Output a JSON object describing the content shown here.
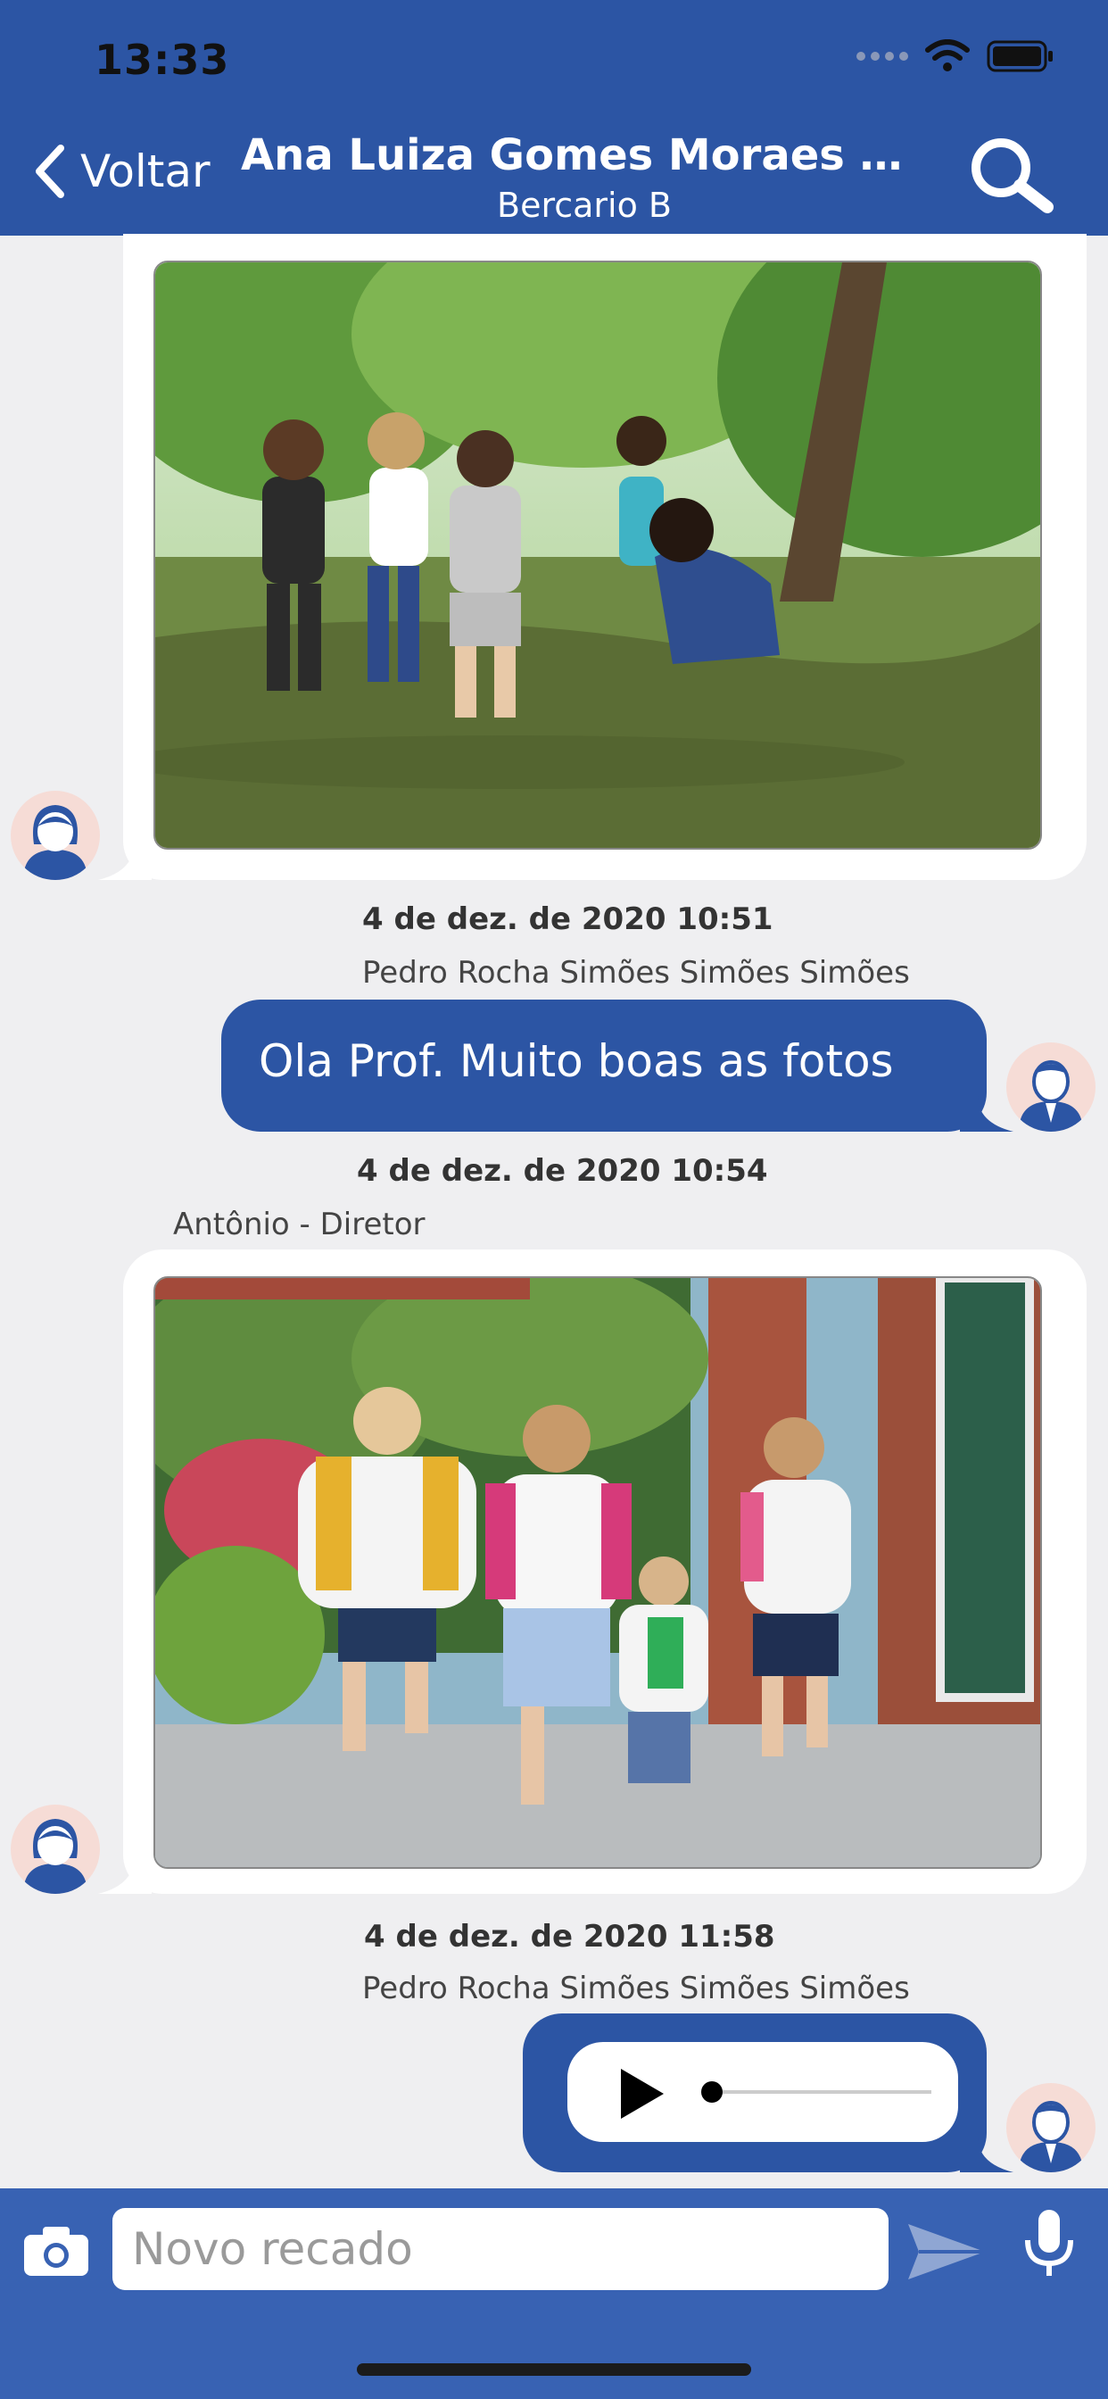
{
  "status_bar": {
    "time": "13:33"
  },
  "header": {
    "back_label": "Voltar",
    "title": "Ana Luiza Gomes Moraes d...",
    "subtitle": "Bercario B"
  },
  "messages": [
    {
      "type": "image",
      "direction": "incoming",
      "photo_subject": "children playing in a circle in a park"
    },
    {
      "type": "text",
      "direction": "outgoing",
      "timestamp": "4 de dez. de 2020 10:51",
      "sender": "Pedro Rocha Simões Simões Simões",
      "text": "Ola Prof. Muito boas as fotos"
    },
    {
      "type": "image",
      "direction": "incoming",
      "timestamp": "4 de dez. de 2020 10:54",
      "sender": "Antônio - Diretor",
      "photo_subject": "masked children with backpacks running at school"
    },
    {
      "type": "audio",
      "direction": "outgoing",
      "timestamp": "4 de dez. de 2020 11:58",
      "sender": "Pedro Rocha Simões Simões Simões"
    }
  ],
  "composer": {
    "placeholder": "Novo recado"
  },
  "colors": {
    "header": "#2c55a4",
    "bubble": "#2c55a4",
    "composer": "#3862b3",
    "background": "#efeff1"
  },
  "icons": [
    "back-chevron-icon",
    "search-icon",
    "camera-icon",
    "send-icon",
    "microphone-icon",
    "play-icon",
    "female-avatar-icon",
    "male-avatar-icon"
  ]
}
